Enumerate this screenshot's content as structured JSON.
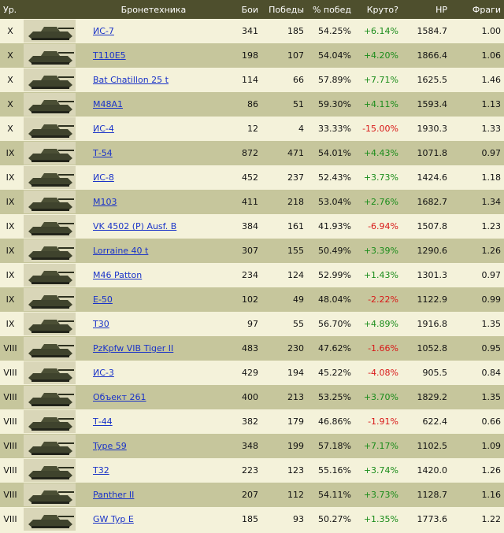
{
  "header": {
    "tier": "Ур.",
    "vehicle": "Бронетехника",
    "battles": "Бои",
    "wins": "Победы",
    "winrate": "% побед",
    "cool": "Круто?",
    "hp": "HP",
    "frags": "Фраги"
  },
  "colors": {
    "header_bg": "#4e4f2d",
    "row_light": "#f4f2da",
    "row_dark": "#c6c69c",
    "link": "#1a33c8",
    "positive": "#1a8c1a",
    "negative": "#d81818"
  },
  "rows": [
    {
      "tier": "X",
      "name": "ИС-7",
      "battles": "341",
      "wins": "185",
      "winrate": "54.25%",
      "cool": "+6.14%",
      "hp": "1584.7",
      "frags": "1.00",
      "icon": "tank-icon"
    },
    {
      "tier": "X",
      "name": "T110E5",
      "battles": "198",
      "wins": "107",
      "winrate": "54.04%",
      "cool": "+4.20%",
      "hp": "1866.4",
      "frags": "1.06",
      "icon": "tank-icon"
    },
    {
      "tier": "X",
      "name": "Bat Chatillon 25 t",
      "battles": "114",
      "wins": "66",
      "winrate": "57.89%",
      "cool": "+7.71%",
      "hp": "1625.5",
      "frags": "1.46",
      "icon": "tank-icon"
    },
    {
      "tier": "X",
      "name": "M48A1",
      "battles": "86",
      "wins": "51",
      "winrate": "59.30%",
      "cool": "+4.11%",
      "hp": "1593.4",
      "frags": "1.13",
      "icon": "tank-icon"
    },
    {
      "tier": "X",
      "name": "ИС-4",
      "battles": "12",
      "wins": "4",
      "winrate": "33.33%",
      "cool": "-15.00%",
      "hp": "1930.3",
      "frags": "1.33",
      "icon": "tank-icon"
    },
    {
      "tier": "IX",
      "name": "Т-54",
      "battles": "872",
      "wins": "471",
      "winrate": "54.01%",
      "cool": "+4.43%",
      "hp": "1071.8",
      "frags": "0.97",
      "icon": "tank-icon"
    },
    {
      "tier": "IX",
      "name": "ИС-8",
      "battles": "452",
      "wins": "237",
      "winrate": "52.43%",
      "cool": "+3.73%",
      "hp": "1424.6",
      "frags": "1.18",
      "icon": "tank-icon"
    },
    {
      "tier": "IX",
      "name": "M103",
      "battles": "411",
      "wins": "218",
      "winrate": "53.04%",
      "cool": "+2.76%",
      "hp": "1682.7",
      "frags": "1.34",
      "icon": "tank-icon"
    },
    {
      "tier": "IX",
      "name": "VK 4502 (P) Ausf. B",
      "battles": "384",
      "wins": "161",
      "winrate": "41.93%",
      "cool": "-6.94%",
      "hp": "1507.8",
      "frags": "1.23",
      "icon": "tank-icon"
    },
    {
      "tier": "IX",
      "name": "Lorraine 40 t",
      "battles": "307",
      "wins": "155",
      "winrate": "50.49%",
      "cool": "+3.39%",
      "hp": "1290.6",
      "frags": "1.26",
      "icon": "tank-icon"
    },
    {
      "tier": "IX",
      "name": "M46 Patton",
      "battles": "234",
      "wins": "124",
      "winrate": "52.99%",
      "cool": "+1.43%",
      "hp": "1301.3",
      "frags": "0.97",
      "icon": "tank-icon"
    },
    {
      "tier": "IX",
      "name": "E-50",
      "battles": "102",
      "wins": "49",
      "winrate": "48.04%",
      "cool": "-2.22%",
      "hp": "1122.9",
      "frags": "0.99",
      "icon": "tank-icon"
    },
    {
      "tier": "IX",
      "name": "T30",
      "battles": "97",
      "wins": "55",
      "winrate": "56.70%",
      "cool": "+4.89%",
      "hp": "1916.8",
      "frags": "1.35",
      "icon": "tank-icon"
    },
    {
      "tier": "VIII",
      "name": "PzKpfw VIB Tiger II",
      "battles": "483",
      "wins": "230",
      "winrate": "47.62%",
      "cool": "-1.66%",
      "hp": "1052.8",
      "frags": "0.95",
      "icon": "tank-icon"
    },
    {
      "tier": "VIII",
      "name": "ИС-3",
      "battles": "429",
      "wins": "194",
      "winrate": "45.22%",
      "cool": "-4.08%",
      "hp": "905.5",
      "frags": "0.84",
      "icon": "tank-icon"
    },
    {
      "tier": "VIII",
      "name": "Объект 261",
      "battles": "400",
      "wins": "213",
      "winrate": "53.25%",
      "cool": "+3.70%",
      "hp": "1829.2",
      "frags": "1.35",
      "icon": "tank-icon"
    },
    {
      "tier": "VIII",
      "name": "Т-44",
      "battles": "382",
      "wins": "179",
      "winrate": "46.86%",
      "cool": "-1.91%",
      "hp": "622.4",
      "frags": "0.66",
      "icon": "tank-icon"
    },
    {
      "tier": "VIII",
      "name": "Type 59",
      "battles": "348",
      "wins": "199",
      "winrate": "57.18%",
      "cool": "+7.17%",
      "hp": "1102.5",
      "frags": "1.09",
      "icon": "tank-icon"
    },
    {
      "tier": "VIII",
      "name": "T32",
      "battles": "223",
      "wins": "123",
      "winrate": "55.16%",
      "cool": "+3.74%",
      "hp": "1420.0",
      "frags": "1.26",
      "icon": "tank-icon"
    },
    {
      "tier": "VIII",
      "name": "Panther II",
      "battles": "207",
      "wins": "112",
      "winrate": "54.11%",
      "cool": "+3.73%",
      "hp": "1128.7",
      "frags": "1.16",
      "icon": "tank-icon"
    },
    {
      "tier": "VIII",
      "name": "GW Typ E",
      "battles": "185",
      "wins": "93",
      "winrate": "50.27%",
      "cool": "+1.35%",
      "hp": "1773.6",
      "frags": "1.22",
      "icon": "tank-icon"
    }
  ]
}
